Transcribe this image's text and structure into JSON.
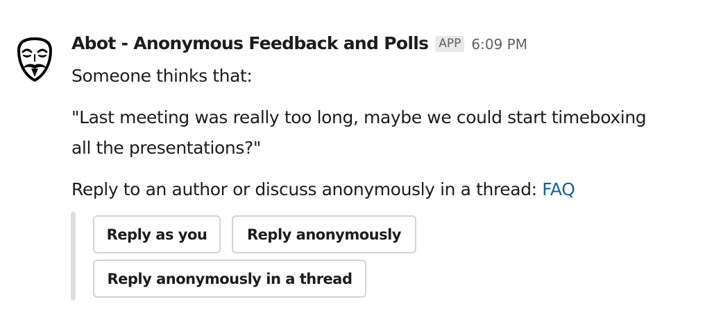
{
  "message": {
    "sender": "Abot - Anonymous Feedback and Polls",
    "badge": "APP",
    "time": "6:09 PM",
    "avatar_icon": "anonymous-mask-icon",
    "intro": "Someone thinks that:",
    "quote_line1": "\"Last meeting was really too long, maybe we could start timeboxing",
    "quote_line2": "all the presentations?\"",
    "prompt_text": "Reply to an author or discuss anonymously in a thread: ",
    "faq_link": "FAQ"
  },
  "actions": {
    "reply_as_you": "Reply as you",
    "reply_anonymously": "Reply anonymously",
    "reply_in_thread": "Reply anonymously in a thread"
  },
  "colors": {
    "text": "#1d1c1d",
    "muted": "#616061",
    "link": "#1264a3",
    "badge_bg": "#e8e8e8",
    "attachment_bar": "#dddddd",
    "button_border": "#d4d4d4"
  }
}
